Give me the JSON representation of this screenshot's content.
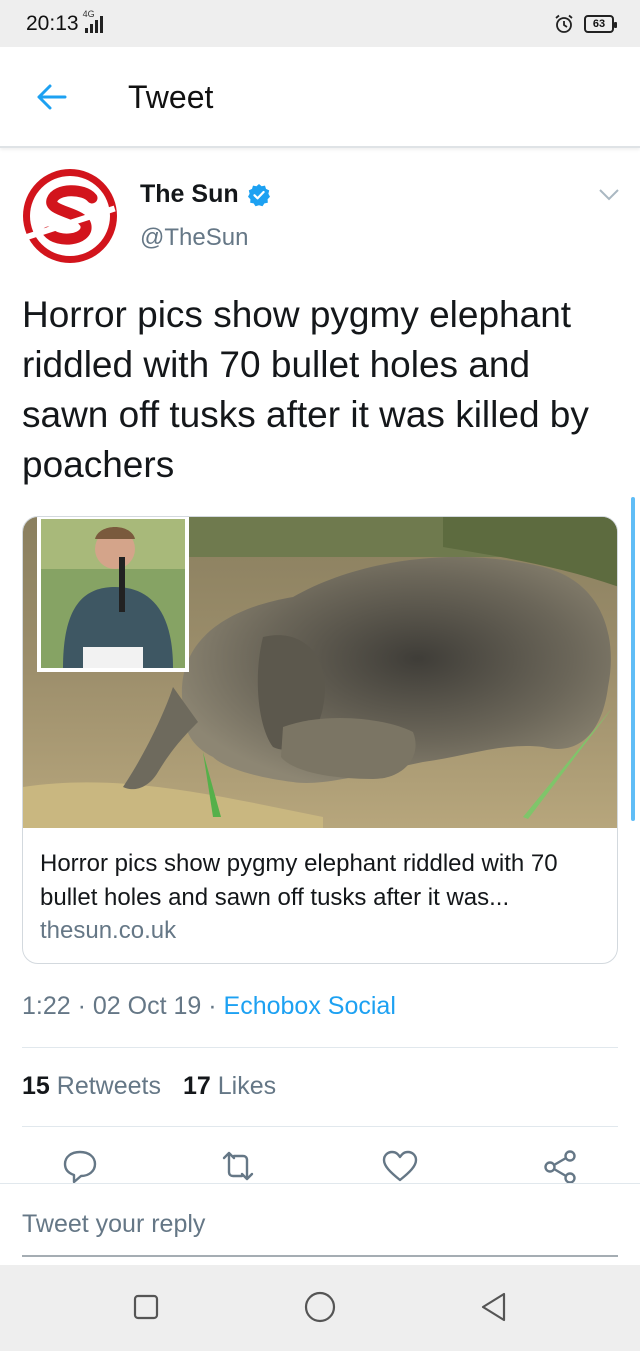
{
  "status_bar": {
    "time": "20:13",
    "network": "4G",
    "battery": "63"
  },
  "header": {
    "title": "Tweet"
  },
  "author": {
    "name": "The Sun",
    "handle": "@TheSun",
    "avatar_letter": "S",
    "brand_color": "#d2141c"
  },
  "tweet": {
    "text": "Horror pics show pygmy elephant riddled with 70 bullet holes and sawn off tusks after it was killed by poachers"
  },
  "card": {
    "title": "Horror pics show pygmy elephant riddled with 70 bullet holes and sawn off tusks after it was...",
    "domain": "thesun.co.uk"
  },
  "meta": {
    "time": "1:22",
    "date": "02 Oct 19",
    "source": "Echobox Social"
  },
  "stats": {
    "retweets_count": "15",
    "retweets_label": "Retweets",
    "likes_count": "17",
    "likes_label": "Likes"
  },
  "reply": {
    "placeholder": "Tweet your reply"
  },
  "colors": {
    "accent": "#1da1f2",
    "text": "#14171a",
    "muted": "#657786"
  },
  "icons": [
    "back-arrow-icon",
    "verified-icon",
    "chevron-down-icon",
    "reply-icon",
    "retweet-icon",
    "like-icon",
    "share-icon",
    "nav-recents-icon",
    "nav-home-icon",
    "nav-back-icon"
  ]
}
